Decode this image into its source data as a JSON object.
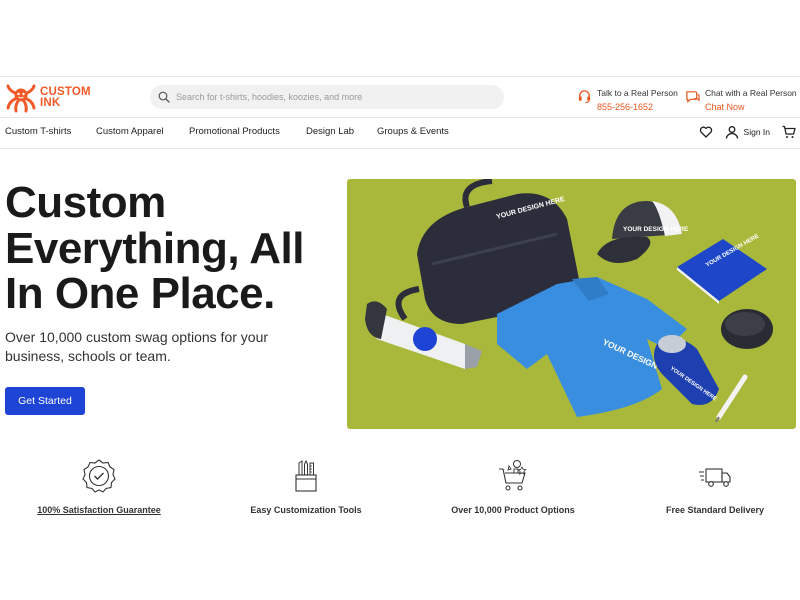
{
  "brand": {
    "name_line1": "CUSTOM",
    "name_line2": "INK",
    "accent_color": "#f05a28",
    "cta_color": "#1e44d6"
  },
  "search": {
    "placeholder": "Search for t-shirts, hoodies, koozies, and more",
    "icon": "search-icon"
  },
  "contact": {
    "phone_label": "Talk to a Real Person",
    "phone_number": "855-256-1652",
    "chat_label": "Chat with a Real Person",
    "chat_action": "Chat Now"
  },
  "nav": {
    "items": [
      "Custom T-shirts",
      "Custom Apparel",
      "Promotional Products",
      "Design Lab",
      "Groups & Events"
    ],
    "sign_in": "Sign In",
    "icons": [
      "heart-icon",
      "user-icon",
      "cart-icon"
    ]
  },
  "hero": {
    "title": "Custom Everything, All In One Place.",
    "subtitle": "Over 10,000 custom swag options for your business, schools or team.",
    "cta_label": "Get Started",
    "image_text": "YOUR DESIGN HERE"
  },
  "features": [
    {
      "label": "100% Satisfaction Guarantee",
      "icon": "badge-check-icon"
    },
    {
      "label": "Easy Customization Tools",
      "icon": "tools-icon"
    },
    {
      "label": "Over 10,000 Product Options",
      "icon": "shopping-cart-icon"
    },
    {
      "label": "Free Standard Delivery",
      "icon": "truck-icon"
    }
  ]
}
